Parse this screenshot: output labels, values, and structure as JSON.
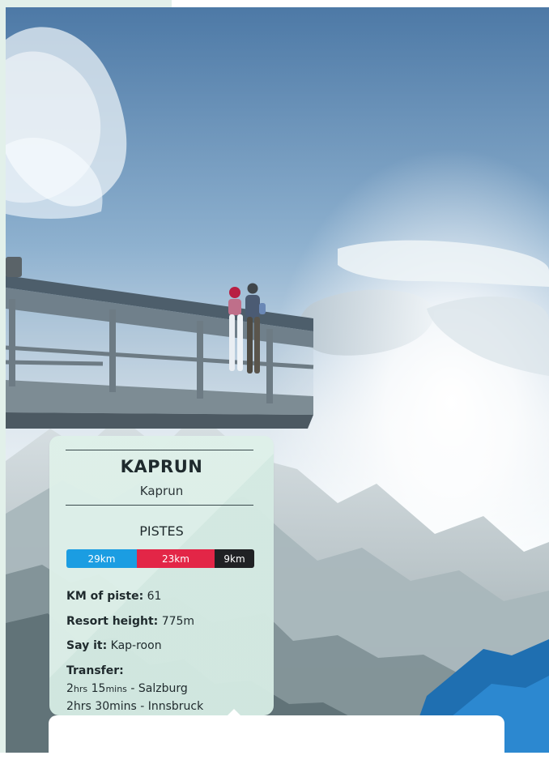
{
  "card": {
    "title": "KAPRUN",
    "subtitle": "Kaprun",
    "pistes_label": "PISTES",
    "pistes": [
      {
        "value": "29km",
        "color": "#1b9de2"
      },
      {
        "value": "23km",
        "color": "#e32647"
      },
      {
        "value": "9km",
        "color": "#202124"
      }
    ],
    "km_of_piste_label": "KM of piste:",
    "km_of_piste_value": "61",
    "resort_height_label": "Resort height:",
    "resort_height_value": "775m",
    "say_it_label": "Say it:",
    "say_it_value": "Kap-roon",
    "transfer_label": "Transfer:",
    "transfer_1_hours": "2",
    "transfer_1_hours_unit": "hrs",
    "transfer_1_mins": "15",
    "transfer_1_mins_unit": "mins",
    "transfer_1_destination": " - Salzburg",
    "transfer_2": "2hrs 30mins - Innsbruck"
  },
  "colors": {
    "mint": "#e2f0ea",
    "card_text": "#1f2a2d"
  }
}
